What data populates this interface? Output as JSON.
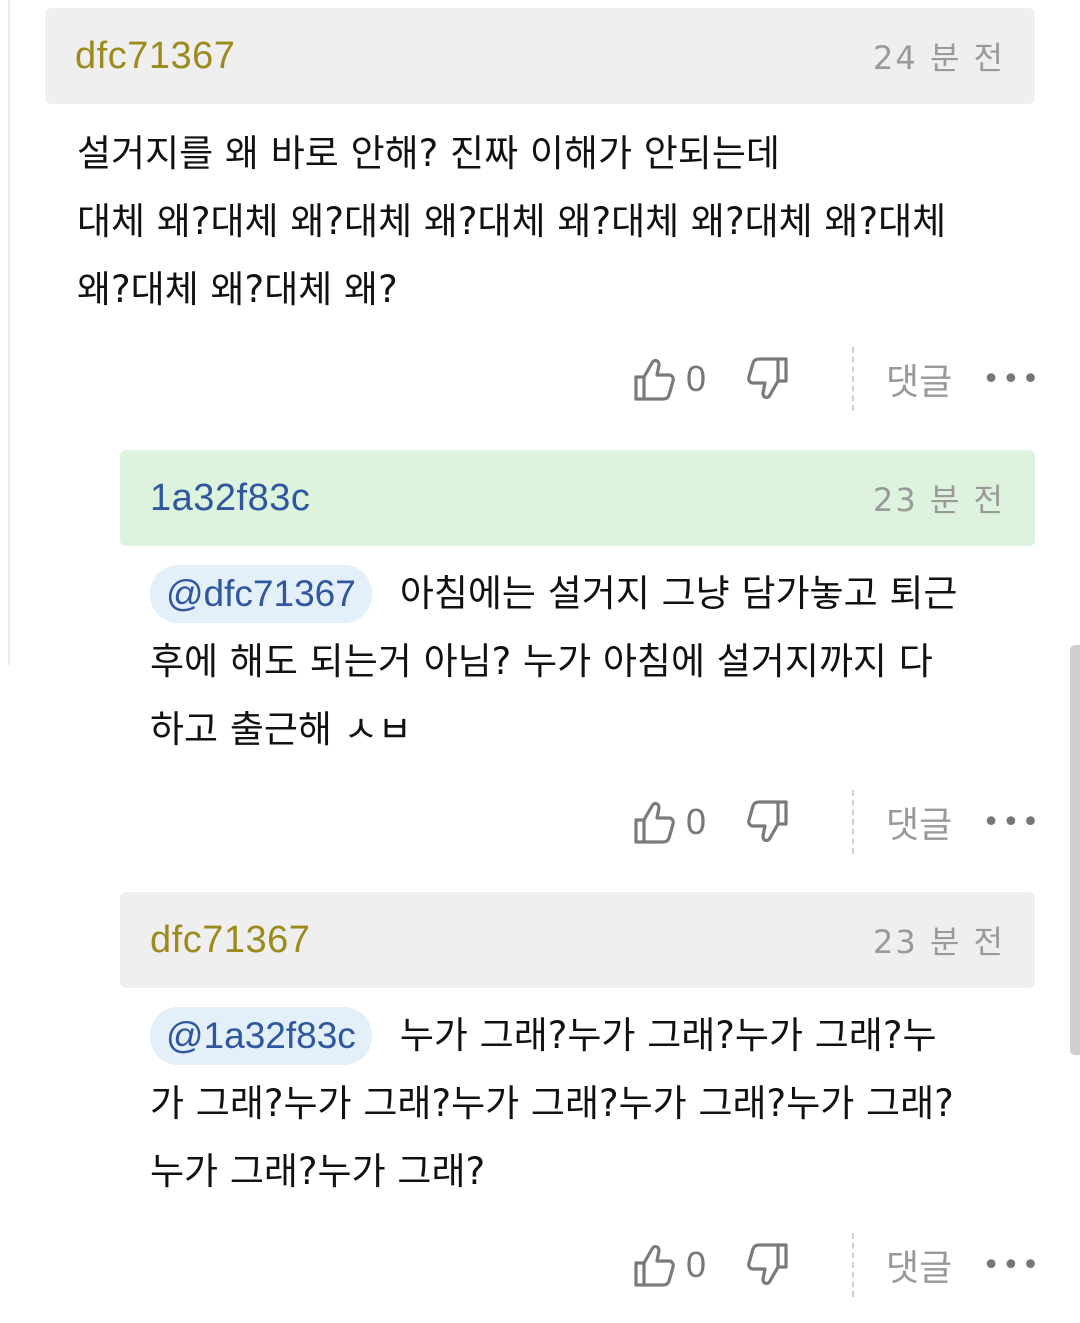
{
  "comments": [
    {
      "author": "dfc71367",
      "author_color": "#9c8a1c",
      "time": "24 분 전",
      "header_color": "#efefef",
      "mention": "",
      "lines": [
        "설거지를 왜 바로 안해? 진짜 이해가 안되는데",
        "대체 왜?대체 왜?대체 왜?대체 왜?대체 왜?대체 왜?대체",
        "왜?대체 왜?대체 왜?"
      ],
      "likes": "0",
      "reply_label": "댓글",
      "more": "•••"
    },
    {
      "author": "1a32f83c",
      "author_color": "#2f57a0",
      "time": "23 분 전",
      "header_color": "#ddf3dd",
      "mention": "@dfc71367",
      "lines": [
        "아침에는 설거지 그냥 담가놓고 퇴근",
        "후에 해도 되는거 아님? 누가 아침에 설거지까지 다",
        "하고 출근해 ㅅㅂ"
      ],
      "likes": "0",
      "reply_label": "댓글",
      "more": "•••"
    },
    {
      "author": "dfc71367",
      "author_color": "#9c8a1c",
      "time": "23 분 전",
      "header_color": "#efefef",
      "mention": "@1a32f83c",
      "lines": [
        "누가 그래?누가 그래?누가 그래?누",
        "가 그래?누가 그래?누가 그래?누가 그래?누가 그래?",
        "누가 그래?누가 그래?"
      ],
      "likes": "0",
      "reply_label": "댓글",
      "more": "•••"
    }
  ]
}
